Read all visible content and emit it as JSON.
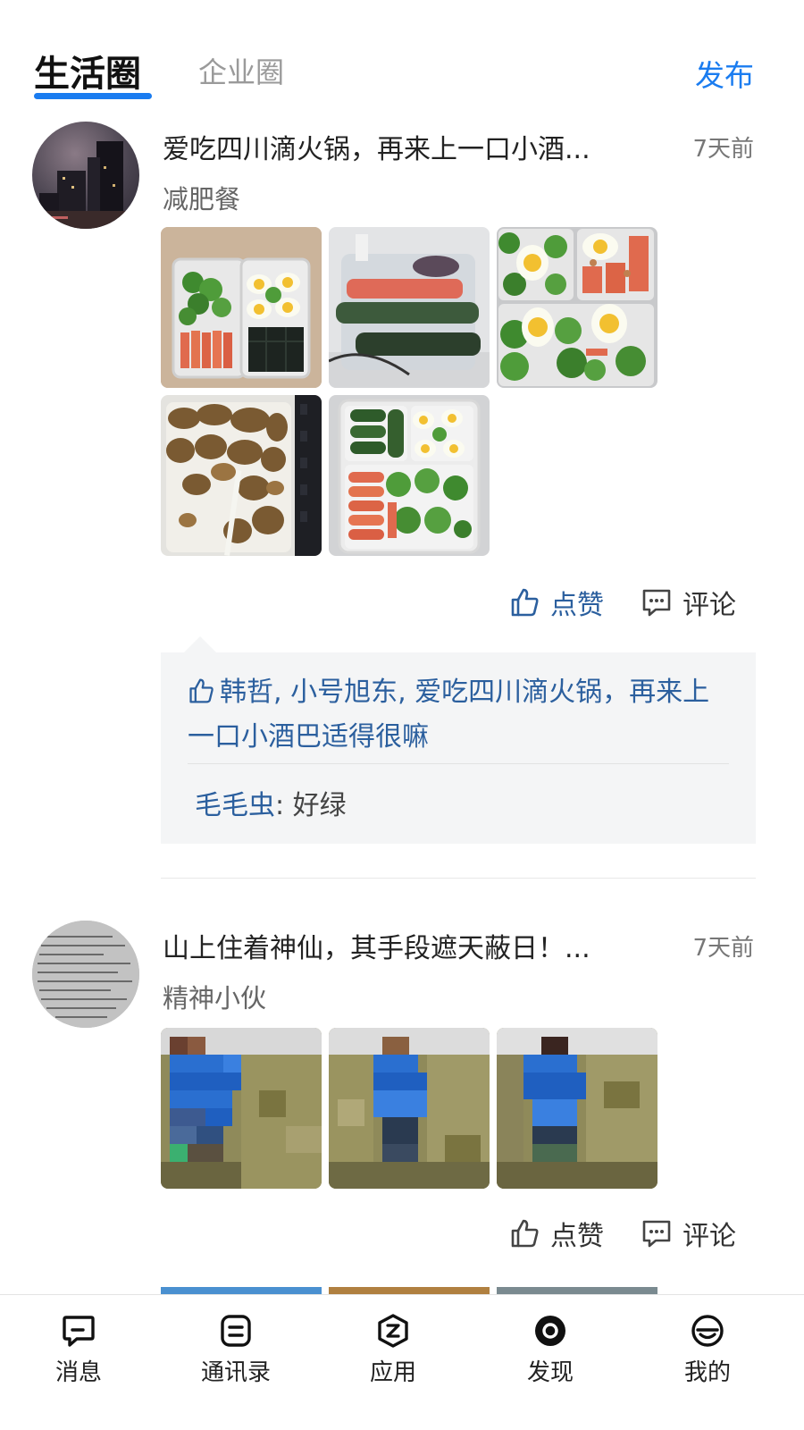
{
  "header": {
    "tab_active": "生活圈",
    "tab_inactive": "企业圈",
    "publish": "发布"
  },
  "posts": [
    {
      "title": "爱吃四川滴火锅，再来上一口小酒...",
      "time": "7天前",
      "author": "减肥餐",
      "like_label": "点赞",
      "comment_label": "评论",
      "liked": true,
      "likers": "韩哲, 小号旭东, 爱吃四川滴火锅，再来上一口小酒巴适得很嘛",
      "comments": [
        {
          "user": "毛毛虫",
          "text": ": 好绿"
        }
      ]
    },
    {
      "title": "山上住着神仙，其手段遮天蔽日！...",
      "time": "7天前",
      "author": "精神小伙",
      "like_label": "点赞",
      "comment_label": "评论",
      "liked": false
    }
  ],
  "bottom_nav": [
    {
      "label": "消息",
      "icon": "message-icon"
    },
    {
      "label": "通讯录",
      "icon": "contacts-icon"
    },
    {
      "label": "应用",
      "icon": "apps-icon"
    },
    {
      "label": "发现",
      "icon": "discover-icon"
    },
    {
      "label": "我的",
      "icon": "profile-icon"
    }
  ],
  "colors": {
    "accent": "#1a7cf0",
    "link": "#2b5f9e",
    "reply_bg": "#f4f5f6"
  }
}
